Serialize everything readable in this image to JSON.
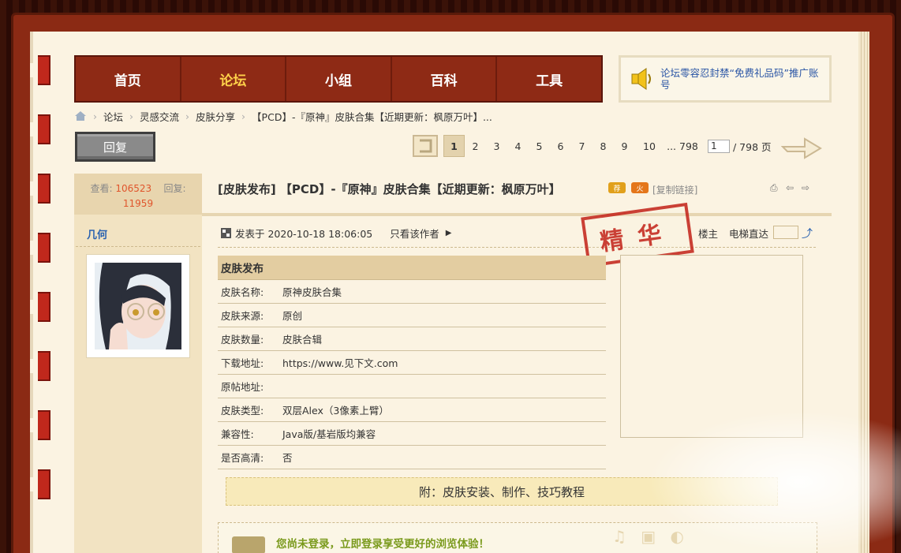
{
  "nav": [
    "首页",
    "论坛",
    "小组",
    "百科",
    "工具"
  ],
  "nav_active": 1,
  "notice": "论坛零容忍封禁“免费礼品码”推广账号",
  "breadcrumb": [
    "论坛",
    "灵感交流",
    "皮肤分享",
    "【PCD】-『原神』皮肤合集【近期更新：枫原万叶】..."
  ],
  "reply_label": "回复",
  "pager": {
    "pages": [
      "1",
      "2",
      "3",
      "4",
      "5",
      "6",
      "7",
      "8",
      "9",
      "10",
      "... 798"
    ],
    "current": "1",
    "input": "1",
    "total": "/ 798 页"
  },
  "stats": {
    "views_label": "查看:",
    "views": "106523",
    "replies_label": "回复:",
    "replies": "11959"
  },
  "author": "几何",
  "post": {
    "title": "[皮肤发布] 【PCD】-『原神』皮肤合集【近期更新：枫原万叶】",
    "badge1": "荐",
    "badge2": "火",
    "copy_link": "[复制链接]",
    "posted": "发表于 2020-10-18 18:06:05",
    "only_author": "只看该作者",
    "louzhu": "楼主",
    "elevator": "电梯直达",
    "stamp": "精华"
  },
  "skin_table": {
    "header": "皮肤发布",
    "rows": [
      {
        "k": "皮肤名称:",
        "v": "原神皮肤合集"
      },
      {
        "k": "皮肤来源:",
        "v": "原创"
      },
      {
        "k": "皮肤数量:",
        "v": "皮肤合辑"
      },
      {
        "k": "下载地址:",
        "v": "https://www.见下文.com"
      },
      {
        "k": "原帖地址:",
        "v": ""
      },
      {
        "k": "皮肤类型:",
        "v": "双层Alex（3像素上臂）"
      },
      {
        "k": "兼容性:",
        "v": "Java版/基岩版均兼容"
      },
      {
        "k": "是否高清:",
        "v": "否"
      }
    ]
  },
  "tutorial": "附：皮肤安装、制作、技巧教程",
  "login_prompt": "您尚未登录，立即登录享受更好的浏览体验！",
  "colors": {
    "nav_bg": "#8e2a15",
    "nav_active": "#ffd24a",
    "page_bg": "#fbf3e2",
    "stamp": "#c4281e",
    "link": "#2a62b0"
  }
}
